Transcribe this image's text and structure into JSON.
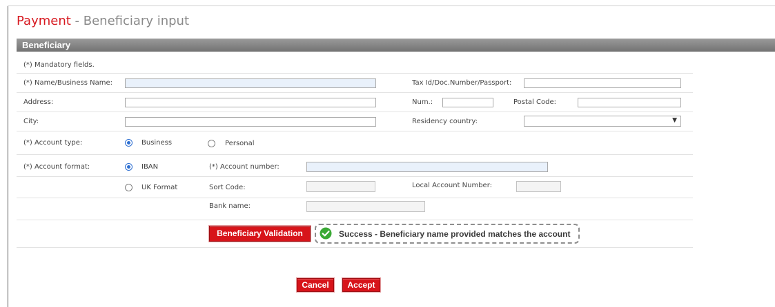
{
  "page": {
    "title_main": "Payment",
    "title_sub": " - Beneficiary input"
  },
  "section": {
    "title": "Beneficiary"
  },
  "form": {
    "mandatory_note": "(*) Mandatory fields.",
    "name_label": "(*) Name/Business Name:",
    "name_value": "",
    "taxid_label": "Tax Id/Doc.Number/Passport:",
    "address_label": "Address:",
    "num_label": "Num.:",
    "postal_label": "Postal Code:",
    "city_label": "City:",
    "residency_label": "Residency country:",
    "residency_value": "",
    "account_type_label": "(*) Account type:",
    "account_type_options": [
      "Business",
      "Personal"
    ],
    "account_type_selected": "Business",
    "account_format_label": "(*) Account format:",
    "account_format_options": [
      "IBAN",
      "UK Format"
    ],
    "account_format_selected": "IBAN",
    "account_number_label": "(*) Account number:",
    "sort_code_label": "Sort Code:",
    "local_account_label": "Local Account Number:",
    "bank_name_label": "Bank name:"
  },
  "validation": {
    "button_label": "Beneficiary Validation",
    "success_message": "Success - Beneficiary name provided matches the account",
    "success_color": "#3aa935"
  },
  "actions": {
    "cancel_label": "Cancel",
    "accept_label": "Accept"
  },
  "colors": {
    "brand_red": "#d71920",
    "section_bar": "#8a8a8a",
    "radio_accent": "#2e6fd1",
    "required_field_bg": "#e9f1fb"
  }
}
